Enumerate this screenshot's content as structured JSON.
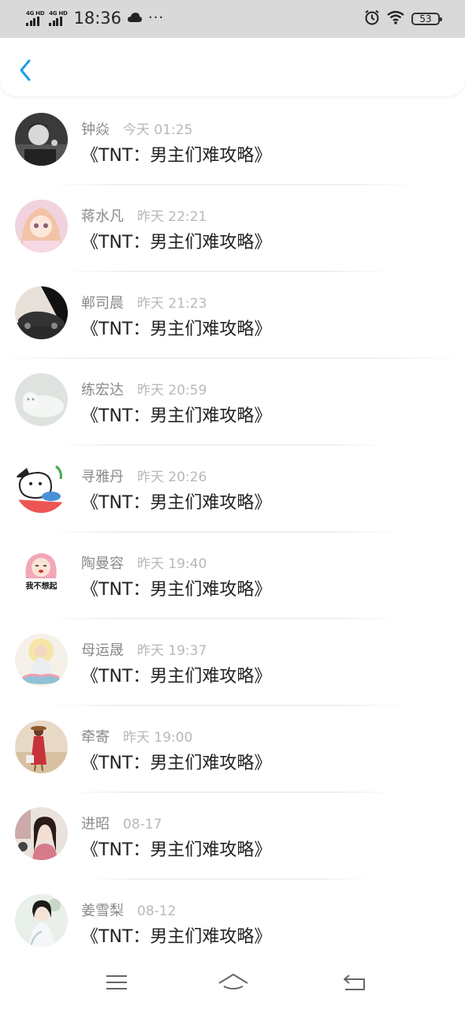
{
  "status_bar": {
    "network_1": "4G HD",
    "network_2": "4G HD",
    "time": "18:36",
    "more": "···",
    "battery": "53",
    "icons": [
      "signal-icon",
      "weather-cloud-icon",
      "alarm-icon",
      "wifi-icon",
      "battery-icon"
    ]
  },
  "header": {
    "back_icon": "chevron-left-icon",
    "accent_color": "#1aa0e6"
  },
  "comments": [
    {
      "name": "钟焱",
      "time": "今天 01:25",
      "message": "《TNT：男主们难攻略》"
    },
    {
      "name": "蒋水凡",
      "time": "昨天 22:21",
      "message": "《TNT：男主们难攻略》"
    },
    {
      "name": "郸司晨",
      "time": "昨天 21:23",
      "message": "《TNT：男主们难攻略》"
    },
    {
      "name": "练宏达",
      "time": "昨天 20:59",
      "message": "《TNT：男主们难攻略》"
    },
    {
      "name": "寻雅丹",
      "time": "昨天 20:26",
      "message": "《TNT：男主们难攻略》"
    },
    {
      "name": "陶曼容",
      "time": "昨天 19:40",
      "message": "《TNT：男主们难攻略》",
      "avatar_text": "我不想起"
    },
    {
      "name": "母运晟",
      "time": "昨天 19:37",
      "message": "《TNT：男主们难攻略》"
    },
    {
      "name": "牵寄",
      "time": "昨天 19:00",
      "message": "《TNT：男主们难攻略》"
    },
    {
      "name": "进昭",
      "time": "08-17",
      "message": "《TNT：男主们难攻略》"
    },
    {
      "name": "姜雪梨",
      "time": "08-12",
      "message": "《TNT：男主们难攻略》"
    }
  ],
  "nav_bar": {
    "icons": [
      "menu-icon",
      "home-icon",
      "back-icon"
    ]
  }
}
